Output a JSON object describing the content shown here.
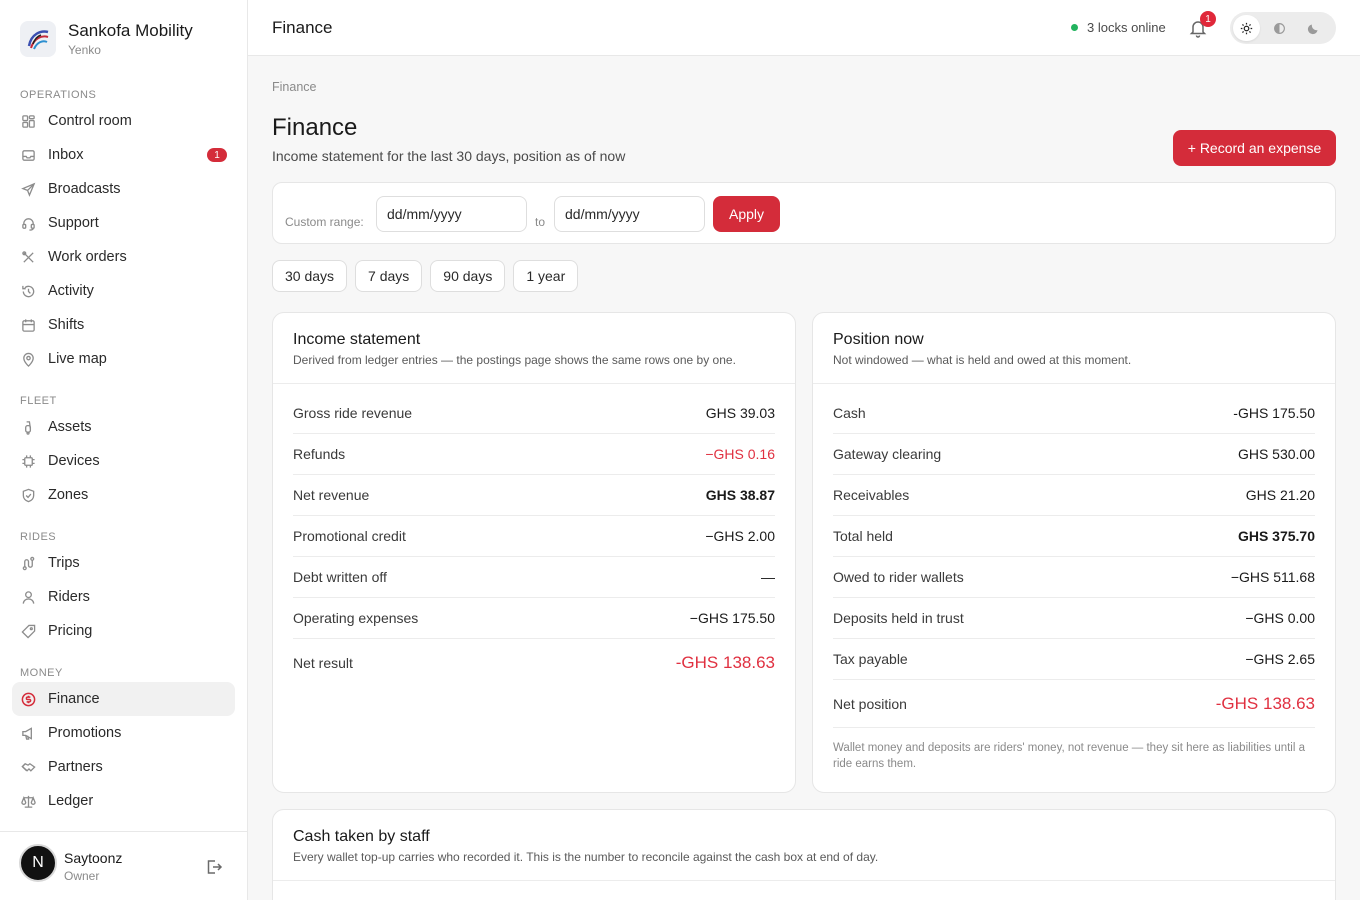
{
  "brand": {
    "name": "Sankofa Mobility",
    "sub": "Yenko"
  },
  "nav": [
    {
      "section": "OPERATIONS",
      "items": [
        {
          "label": "Control room",
          "icon": "grid-icon"
        },
        {
          "label": "Inbox",
          "icon": "inbox-icon",
          "badge": "1"
        },
        {
          "label": "Broadcasts",
          "icon": "send-icon"
        },
        {
          "label": "Support",
          "icon": "headset-icon"
        },
        {
          "label": "Work orders",
          "icon": "tools-icon"
        },
        {
          "label": "Activity",
          "icon": "history-icon"
        },
        {
          "label": "Shifts",
          "icon": "calendar-icon"
        },
        {
          "label": "Live map",
          "icon": "map-pin-icon"
        }
      ]
    },
    {
      "section": "FLEET",
      "items": [
        {
          "label": "Assets",
          "icon": "scooter-icon"
        },
        {
          "label": "Devices",
          "icon": "chip-icon"
        },
        {
          "label": "Zones",
          "icon": "shield-icon"
        }
      ]
    },
    {
      "section": "RIDES",
      "items": [
        {
          "label": "Trips",
          "icon": "route-icon"
        },
        {
          "label": "Riders",
          "icon": "user-icon"
        },
        {
          "label": "Pricing",
          "icon": "tag-icon"
        }
      ]
    },
    {
      "section": "MONEY",
      "items": [
        {
          "label": "Finance",
          "icon": "dollar-circle-icon",
          "active": true
        },
        {
          "label": "Promotions",
          "icon": "megaphone-icon"
        },
        {
          "label": "Partners",
          "icon": "handshake-icon"
        },
        {
          "label": "Ledger",
          "icon": "scale-icon"
        }
      ]
    }
  ],
  "user": {
    "initial": "N",
    "name": "Saytoonz",
    "role": "Owner"
  },
  "topbar": {
    "title": "Finance",
    "locks": "3 locks online",
    "bell_count": "1"
  },
  "page": {
    "breadcrumb": "Finance",
    "title": "Finance",
    "subtitle": "Income statement for the last 30 days, position as of now",
    "record_button": "+ Record an expense"
  },
  "range": {
    "label": "Custom range:",
    "from_placeholder": "dd/mm/yyyy",
    "to_label": "to",
    "to_placeholder": "dd/mm/yyyy",
    "apply": "Apply"
  },
  "presets": [
    "30 days",
    "7 days",
    "90 days",
    "1 year"
  ],
  "income": {
    "title": "Income statement",
    "desc": "Derived from ledger entries — the postings page shows the same rows one by one.",
    "rows": [
      {
        "label": "Gross ride revenue",
        "value": "GHS 39.03"
      },
      {
        "label": "Refunds",
        "value": "−GHS 0.16"
      },
      {
        "label": "Net revenue",
        "value": "GHS 38.87"
      },
      {
        "label": "Promotional credit",
        "value": "−GHS 2.00"
      },
      {
        "label": "Debt written off",
        "value": "—"
      },
      {
        "label": "Operating expenses",
        "value": "−GHS 175.50"
      },
      {
        "label": "Net result",
        "value": "-GHS 138.63"
      }
    ]
  },
  "position": {
    "title": "Position now",
    "desc": "Not windowed — what is held and owed at this moment.",
    "rows": [
      {
        "label": "Cash",
        "value": "-GHS 175.50"
      },
      {
        "label": "Gateway clearing",
        "value": "GHS 530.00"
      },
      {
        "label": "Receivables",
        "value": "GHS 21.20"
      },
      {
        "label": "Total held",
        "value": "GHS 375.70"
      },
      {
        "label": "Owed to rider wallets",
        "value": "−GHS 511.68"
      },
      {
        "label": "Deposits held in trust",
        "value": "−GHS 0.00"
      },
      {
        "label": "Tax payable",
        "value": "−GHS 2.65"
      },
      {
        "label": "Net position",
        "value": "-GHS 138.63"
      }
    ],
    "note": "Wallet money and deposits are riders' money, not revenue — they sit here as liabilities until a ride earns them."
  },
  "cash_staff": {
    "title": "Cash taken by staff",
    "desc": "Every wallet top-up carries who recorded it. This is the number to reconcile against the cash box at end of day."
  },
  "colors": {
    "accent": "#d42c3a",
    "negative": "#e03040",
    "online": "#22b35e"
  }
}
